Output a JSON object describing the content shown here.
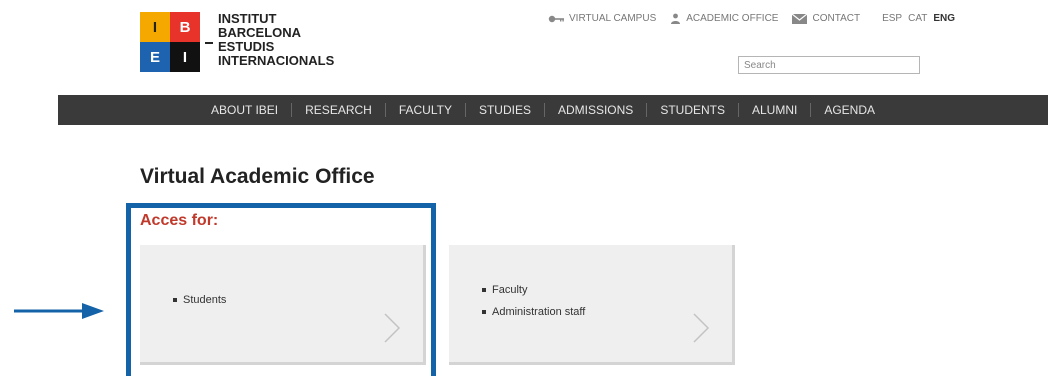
{
  "logo": {
    "letters": [
      "I",
      "B",
      "E",
      "I"
    ],
    "lines": [
      "INSTITUT",
      "BARCELONA",
      "ESTUDIS",
      "INTERNACIONALS"
    ]
  },
  "toplinks": {
    "virtual_campus": "VIRTUAL CAMPUS",
    "academic_office": "ACADEMIC OFFICE",
    "contact": "CONTACT"
  },
  "languages": [
    "ESP",
    "CAT",
    "ENG"
  ],
  "search": {
    "placeholder": "Search"
  },
  "nav": [
    "ABOUT IBEI",
    "RESEARCH",
    "FACULTY",
    "STUDIES",
    "ADMISSIONS",
    "STUDENTS",
    "ALUMNI",
    "AGENDA"
  ],
  "page": {
    "title": "Virtual Academic Office",
    "acces_label": "Acces for:"
  },
  "cards": [
    {
      "items": [
        "Students"
      ]
    },
    {
      "items": [
        "Faculty",
        "Administration staff"
      ]
    }
  ],
  "colors": {
    "logo_yellow": "#f5a800",
    "logo_red": "#e8332a",
    "logo_blue": "#1e63b0",
    "logo_black": "#111111",
    "navbar": "#3a3a3a",
    "accent_red": "#c0392b",
    "highlight_blue": "#1462a8"
  }
}
